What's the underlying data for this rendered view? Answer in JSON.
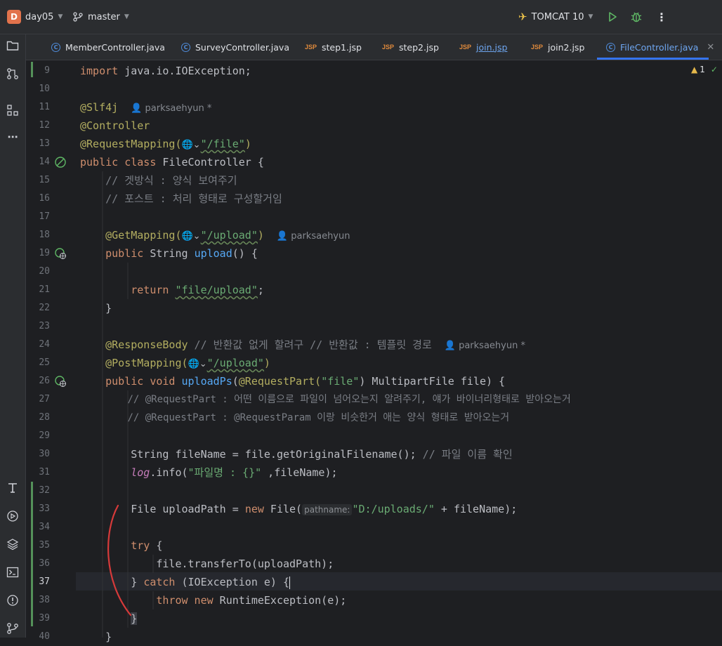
{
  "header": {
    "project_initial": "D",
    "project": "day05",
    "branch": "master",
    "run_config": "TOMCAT 10"
  },
  "tabs": [
    {
      "label": "MemberController.java",
      "type": "class"
    },
    {
      "label": "SurveyController.java",
      "type": "class"
    },
    {
      "label": "step1.jsp",
      "type": "jsp"
    },
    {
      "label": "step2.jsp",
      "type": "jsp"
    },
    {
      "label": "join.jsp",
      "type": "jsp"
    },
    {
      "label": "join2.jsp",
      "type": "jsp"
    },
    {
      "label": "FileController.java",
      "type": "class",
      "active": true
    }
  ],
  "jsp_badge": "JSP",
  "inspection": {
    "warnings": "1"
  },
  "editor": {
    "line_numbers": [
      "9",
      "10",
      "11",
      "12",
      "13",
      "14",
      "15",
      "16",
      "17",
      "18",
      "19",
      "20",
      "21",
      "22",
      "23",
      "24",
      "25",
      "26",
      "27",
      "28",
      "29",
      "30",
      "31",
      "32",
      "33",
      "34",
      "35",
      "36",
      "37",
      "38",
      "39",
      "40"
    ],
    "current_line": "37",
    "authors": {
      "a11": "parksaehyun *",
      "a18": "parksaehyun",
      "a24": "parksaehyun *"
    },
    "hint_pathname": "pathname:",
    "code": {
      "l9_kw": "import",
      "l9_rest": " java.io.IOException;",
      "l11": "@Slf4j",
      "l12": "@Controller",
      "l13_ann": "@RequestMapping(",
      "l13_str": "\"/file\"",
      "l13_end": ")",
      "l14_kw": "public class",
      "l14_rest": " FileController {",
      "l15": "    // 겟방식 : 양식 보여주기",
      "l16": "    // 포스트 : 처리 형태로 구성할거임",
      "l18_ann": "@GetMapping(",
      "l18_str": "\"/upload\"",
      "l18_end": ")",
      "l19_kw": "public",
      "l19_type": " String ",
      "l19_fn": "upload",
      "l19_end": "() {",
      "l21_kw": "return",
      "l21_str": "\"file/upload\"",
      "l21_end": ";",
      "l22": "}",
      "l24_ann": "@ResponseBody",
      "l24_cmt": " // 반환값 없게 할려구 // 반환값 : 템플릿 경로",
      "l25_ann": "@PostMapping(",
      "l25_str": "\"/upload\"",
      "l25_end": ")",
      "l26_kw": "public void",
      "l26_fn": "uploadPs",
      "l26_a": "(",
      "l26_ann": "@RequestPart(",
      "l26_str": "\"file\"",
      "l26_end": ") MultipartFile file) {",
      "l27": "// @RequestPart : 어떤 이름으로 파일이 넘어오는지 알려주기, 얘가 바이너리형태로 받아오는거",
      "l28": "// @RequestPart : @RequestParam 이랑 비슷한거 애는 양식 형태로 받아오는거",
      "l30_code": "String fileName = file.getOriginalFilename();",
      "l30_cmt": " // 파일 이름 확인",
      "l31_log": "log",
      "l31_a": ".info(",
      "l31_str": "\"파일명 : {}\"",
      "l31_end": " ,fileName);",
      "l33_a": "File uploadPath = ",
      "l33_kw": "new",
      "l33_b": " File(",
      "l33_str": "\"D:/uploads/\"",
      "l33_end": " + fileName);",
      "l35_kw": "try",
      "l35_end": " {",
      "l36": "file.transferTo(uploadPath);",
      "l37_a": "} ",
      "l37_kw": "catch",
      "l37_end": " (IOException e) {",
      "l38_kw": "throw new",
      "l38_end": " RuntimeException(e);",
      "l39": "}",
      "l40": "}"
    }
  }
}
